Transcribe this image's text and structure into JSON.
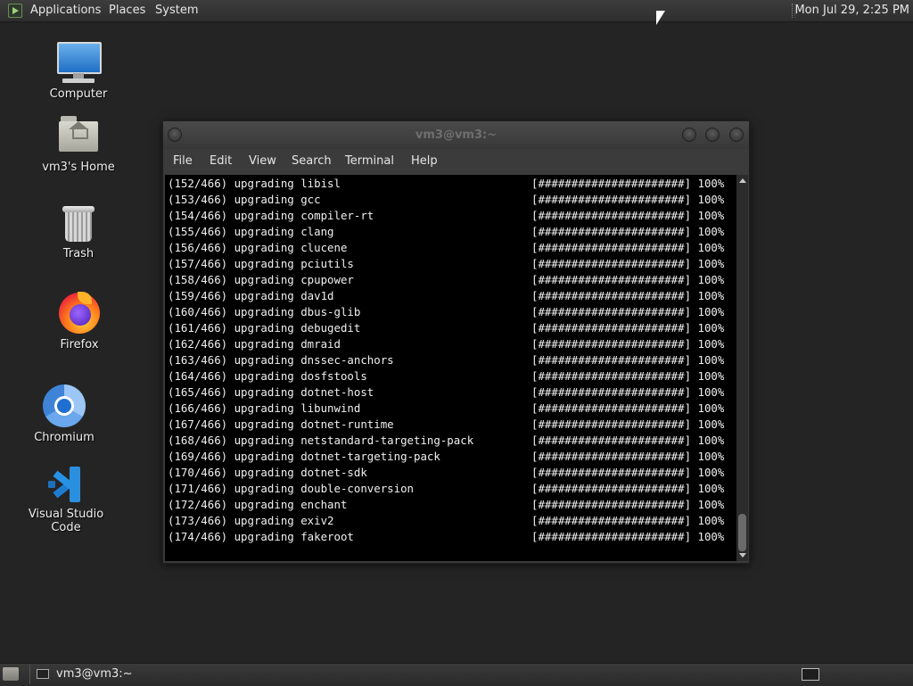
{
  "top_panel": {
    "menus": [
      "Applications",
      "Places",
      "System"
    ],
    "clock": "Mon Jul 29,  2:25 PM"
  },
  "desktop": {
    "icons": [
      {
        "label": "Computer",
        "icon": "computer-icon"
      },
      {
        "label": "vm3's Home",
        "icon": "home-folder-icon"
      },
      {
        "label": "Trash",
        "icon": "trash-icon"
      },
      {
        "label": "Firefox",
        "icon": "firefox-icon"
      },
      {
        "label": "Chromium",
        "icon": "chromium-icon"
      },
      {
        "label": "Visual Studio Code",
        "icon": "vscode-icon"
      }
    ]
  },
  "terminal": {
    "title": "vm3@vm3:~",
    "menu": [
      "File",
      "Edit",
      "View",
      "Search",
      "Terminal",
      "Help"
    ],
    "progress_bar": "[######################]",
    "lines": [
      {
        "text": "(152/466) upgrading libisl",
        "pct": "100%"
      },
      {
        "text": "(153/466) upgrading gcc",
        "pct": "100%"
      },
      {
        "text": "(154/466) upgrading compiler-rt",
        "pct": "100%"
      },
      {
        "text": "(155/466) upgrading clang",
        "pct": "100%"
      },
      {
        "text": "(156/466) upgrading clucene",
        "pct": "100%"
      },
      {
        "text": "(157/466) upgrading pciutils",
        "pct": "100%"
      },
      {
        "text": "(158/466) upgrading cpupower",
        "pct": "100%"
      },
      {
        "text": "(159/466) upgrading dav1d",
        "pct": "100%"
      },
      {
        "text": "(160/466) upgrading dbus-glib",
        "pct": "100%"
      },
      {
        "text": "(161/466) upgrading debugedit",
        "pct": "100%"
      },
      {
        "text": "(162/466) upgrading dmraid",
        "pct": "100%"
      },
      {
        "text": "(163/466) upgrading dnssec-anchors",
        "pct": "100%"
      },
      {
        "text": "(164/466) upgrading dosfstools",
        "pct": "100%"
      },
      {
        "text": "(165/466) upgrading dotnet-host",
        "pct": "100%"
      },
      {
        "text": "(166/466) upgrading libunwind",
        "pct": "100%"
      },
      {
        "text": "(167/466) upgrading dotnet-runtime",
        "pct": "100%"
      },
      {
        "text": "(168/466) upgrading netstandard-targeting-pack",
        "pct": "100%"
      },
      {
        "text": "(169/466) upgrading dotnet-targeting-pack",
        "pct": "100%"
      },
      {
        "text": "(170/466) upgrading dotnet-sdk",
        "pct": "100%"
      },
      {
        "text": "(171/466) upgrading double-conversion",
        "pct": "100%"
      },
      {
        "text": "(172/466) upgrading enchant",
        "pct": "100%"
      },
      {
        "text": "(173/466) upgrading exiv2",
        "pct": "100%"
      },
      {
        "text": "(174/466) upgrading fakeroot",
        "pct": "100%"
      }
    ]
  },
  "bottom_panel": {
    "tasks": [
      {
        "label": "vm3@vm3:~",
        "icon": "terminal-icon"
      }
    ]
  }
}
